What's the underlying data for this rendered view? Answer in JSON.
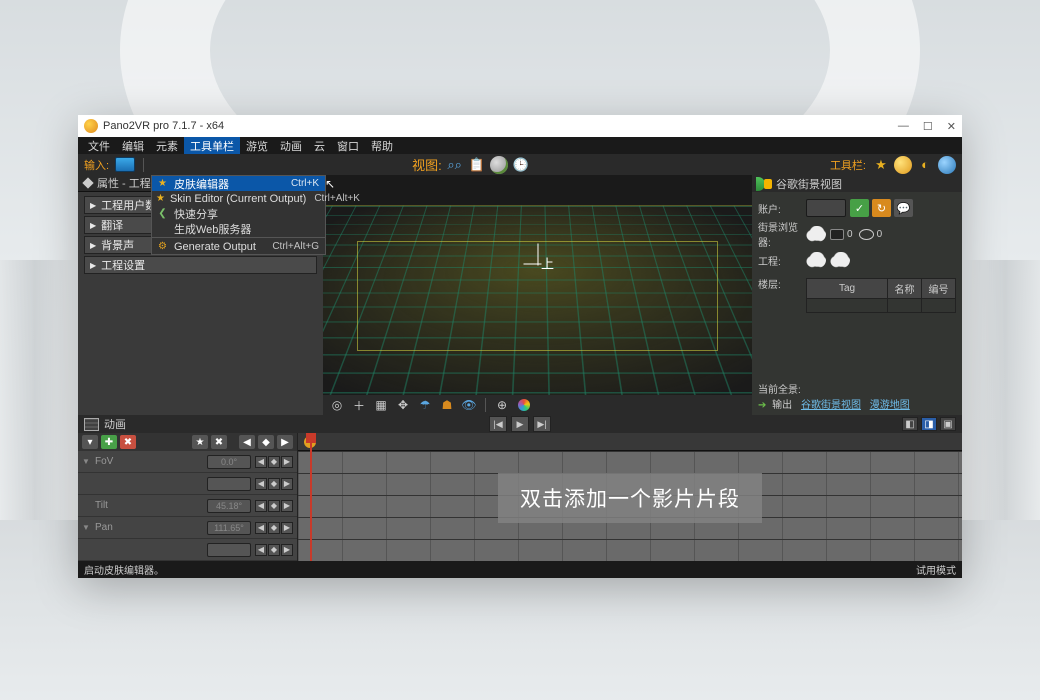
{
  "title": "Pano2VR pro 7.1.7 - x64",
  "menubar": [
    "文件",
    "编辑",
    "元素",
    "工具单栏",
    "游览",
    "动画",
    "云",
    "窗口",
    "帮助"
  ],
  "active_menu_index": 3,
  "menu_items": [
    {
      "icon": "★",
      "label": "皮肤编辑器",
      "shortcut": "Ctrl+K",
      "highlight": true
    },
    {
      "icon": "★",
      "label": "Skin Editor (Current Output)",
      "shortcut": "Ctrl+Alt+K"
    },
    {
      "icon": "❮",
      "label": "快速分享",
      "shortcut": ""
    },
    {
      "icon": "",
      "label": "生成Web服务器",
      "shortcut": ""
    },
    {
      "icon": "⚙",
      "label": "Generate Output",
      "shortcut": "Ctrl+Alt+G",
      "divider_before": true
    }
  ],
  "toolbar": {
    "input_label": "输入:",
    "view_label": "视图:",
    "right_label": "工具栏:"
  },
  "left_panel": {
    "tab": "属性 - 工程",
    "items": [
      "工程用户数据",
      "翻译",
      "背景声",
      "工程设置"
    ]
  },
  "viewport": {
    "center_mark": "上"
  },
  "right_panel": {
    "title": "谷歌街景视图",
    "rows": {
      "account": "账户:",
      "browser": "街景浏览器:",
      "project": "工程:",
      "bldg": "楼层:"
    },
    "cam_count": "0",
    "eye_count": "0",
    "table_headers": [
      "Tag",
      "名称",
      "编号"
    ],
    "footer_label": "当前全景:",
    "output_label": "输出",
    "links": [
      "谷歌街景视图",
      "漫游地图"
    ]
  },
  "anim": {
    "title": "动画",
    "rows": [
      {
        "name": "FoV",
        "val": "0.0°"
      },
      {
        "name": "",
        "val": ""
      },
      {
        "name": "Tilt",
        "val": "45.18°"
      },
      {
        "name": "Pan",
        "val": "111.65°"
      },
      {
        "name": "",
        "val": ""
      }
    ],
    "hint": "双击添加一个影片片段"
  },
  "status": {
    "left": "启动皮肤编辑器。",
    "right": "试用模式"
  }
}
